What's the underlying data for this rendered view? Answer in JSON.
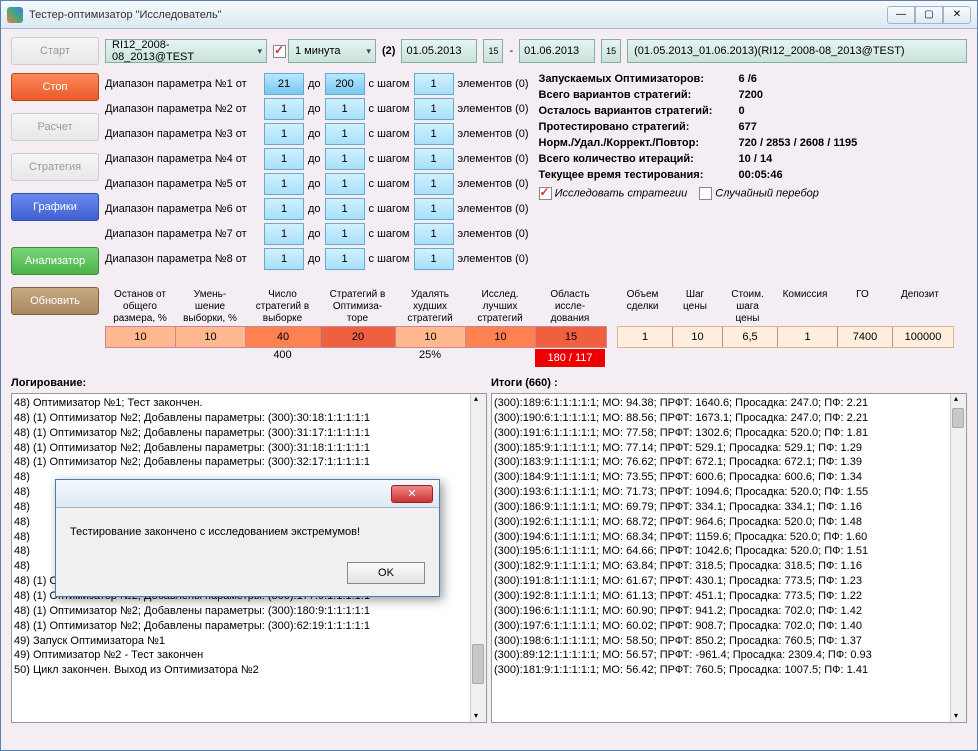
{
  "window": {
    "title": "Тестер-оптимизатор \"Исследователь\""
  },
  "top": {
    "strategy": "RI12_2008-08_2013@TEST",
    "timeframe": "1 минута",
    "count": "(2)",
    "date_from": "01.05.2013",
    "date_to": "01.06.2013",
    "info": "(01.05.2013_01.06.2013)(RI12_2008-08_2013@TEST)"
  },
  "buttons": {
    "start": "Старт",
    "stop": "Стоп",
    "calc": "Расчет",
    "strategy": "Стратегия",
    "charts": "Графики",
    "analyzer": "Анализатор",
    "refresh": "Обновить"
  },
  "params": [
    {
      "label": "Диапазон параметра №1 от",
      "from": "21",
      "to": "200",
      "step": "1",
      "elem": "элементов (0)"
    },
    {
      "label": "Диапазон параметра №2 от",
      "from": "1",
      "to": "1",
      "step": "1",
      "elem": "элементов (0)"
    },
    {
      "label": "Диапазон параметра №3 от",
      "from": "1",
      "to": "1",
      "step": "1",
      "elem": "элементов (0)"
    },
    {
      "label": "Диапазон параметра №4 от",
      "from": "1",
      "to": "1",
      "step": "1",
      "elem": "элементов (0)"
    },
    {
      "label": "Диапазон параметра №5 от",
      "from": "1",
      "to": "1",
      "step": "1",
      "elem": "элементов (0)"
    },
    {
      "label": "Диапазон параметра №6 от",
      "from": "1",
      "to": "1",
      "step": "1",
      "elem": "элементов (0)"
    },
    {
      "label": "Диапазон параметра №7 от",
      "from": "1",
      "to": "1",
      "step": "1",
      "elem": "элементов (0)"
    },
    {
      "label": "Диапазон параметра №8 от",
      "from": "1",
      "to": "1",
      "step": "1",
      "elem": "элементов (0)"
    }
  ],
  "words": {
    "to": "до",
    "step": "с шагом"
  },
  "stats": {
    "s1_label": "Запускаемых Оптимизаторов:",
    "s1_val": "6 /6",
    "s2_label": "Всего вариантов стратегий:",
    "s2_val": "7200",
    "s3_label": "Осталось вариантов стратегий:",
    "s3_val": "0",
    "s4_label": "Протестировано стратегий:",
    "s4_val": "677",
    "s5_label": "Норм./Удал./Коррект./Повтор:",
    "s5_val": "720 / 2853 / 2608 / 1195",
    "s6_label": "Всего количество итераций:",
    "s6_val": "10 / 14",
    "s7_label": "Текущее время тестирования:",
    "s7_val": "00:05:46"
  },
  "checks": {
    "research": "Исследовать стратегии",
    "random": "Случайный перебор"
  },
  "table": {
    "h1": "Останов от\nобщего\nразмера, %",
    "h2": "Умень-\nшение\nвыборки, %",
    "h3": "Число\nстратегий в\nвыборке",
    "h4": "Стратегий в\nОптимиза-\nторе",
    "h5": "Удалять\nхудших\nстратегий",
    "h6": "Исслед.\nлучших\nстратегий",
    "h7": "Область\nиссле-\nдования",
    "h8": "Объем\nсделки",
    "h9": "Шаг\nцены",
    "h10": "Стоим.\nшага\nцены",
    "h11": "Комиссия",
    "h12": "ГО",
    "h13": "Депозит",
    "v1": "10",
    "v2": "10",
    "v3": "40",
    "v4": "20",
    "v5": "10",
    "v6": "10",
    "v7": "15",
    "v8": "1",
    "v9": "10",
    "v10": "6,5",
    "v11": "1",
    "v12": "7400",
    "v13": "100000",
    "below3": "400",
    "below5": "25%",
    "below7": "180 / 117"
  },
  "log_title": "Логирование:",
  "results_title": "Итоги (660) :",
  "log_lines": [
    "48) Оптимизатор №1; Тест закончен.",
    "48) (1) Оптимизатор №2; Добавлены параметры: (300):30:18:1:1:1:1:1",
    "48) (1) Оптимизатор №2; Добавлены параметры: (300):31:17:1:1:1:1:1",
    "48) (1) Оптимизатор №2; Добавлены параметры: (300):31:18:1:1:1:1:1",
    "48) (1) Оптимизатор №2; Добавлены параметры: (300):32:17:1:1:1:1:1",
    "48)",
    "48)",
    "48)",
    "48)",
    "48)",
    "48)",
    "48)",
    "48) (1) Оптимизатор №2; Добавлены параметры: (300):176:9:1:1:1:1:1",
    "48) (1) Оптимизатор №2; Добавлены параметры: (300):177:9:1:1:1:1:1",
    "48) (1) Оптимизатор №2; Добавлены параметры: (300):180:9:1:1:1:1:1",
    "48) (1) Оптимизатор №2; Добавлены параметры: (300):62:19:1:1:1:1:1",
    "49) Запуск Оптимизатора №1",
    "49) Оптимизатор №2 - Тест закончен",
    "50) Цикл закончен. Выход из Оптимизатора №2"
  ],
  "result_lines": [
    "(300):189:6:1:1:1:1:1; МО: 94.38; ПРФТ: 1640.6; Просадка: 247.0; ПФ: 2.21",
    "(300):190:6:1:1:1:1:1; МО: 88.56; ПРФТ: 1673.1; Просадка: 247.0; ПФ: 2.21",
    "(300):191:6:1:1:1:1:1; МО: 77.58; ПРФТ: 1302.6; Просадка: 520.0; ПФ: 1.81",
    "(300):185:9:1:1:1:1:1; МО: 77.14; ПРФТ: 529.1; Просадка: 529.1; ПФ: 1.29",
    "(300):183:9:1:1:1:1:1; МО: 76.62; ПРФТ: 672.1; Просадка: 672.1; ПФ: 1.39",
    "(300):184:9:1:1:1:1:1; МО: 73.55; ПРФТ: 600.6; Просадка: 600.6; ПФ: 1.34",
    "(300):193:6:1:1:1:1:1; МО: 71.73; ПРФТ: 1094.6; Просадка: 520.0; ПФ: 1.55",
    "(300):186:9:1:1:1:1:1; МО: 69.79; ПРФТ: 334.1; Просадка: 334.1; ПФ: 1.16",
    "(300):192:6:1:1:1:1:1; МО: 68.72; ПРФТ: 964.6; Просадка: 520.0; ПФ: 1.48",
    "(300):194:6:1:1:1:1:1; МО: 68.34; ПРФТ: 1159.6; Просадка: 520.0; ПФ: 1.60",
    "(300):195:6:1:1:1:1:1; МО: 64.66; ПРФТ: 1042.6; Просадка: 520.0; ПФ: 1.51",
    "(300):182:9:1:1:1:1:1; МО: 63.84; ПРФТ: 318.5; Просадка: 318.5; ПФ: 1.16",
    "(300):191:8:1:1:1:1:1; МО: 61.67; ПРФТ: 430.1; Просадка: 773.5; ПФ: 1.23",
    "(300):192:8:1:1:1:1:1; МО: 61.13; ПРФТ: 451.1; Просадка: 773.5; ПФ: 1.22",
    "(300):196:6:1:1:1:1:1; МО: 60.90; ПРФТ: 941.2; Просадка: 702.0; ПФ: 1.42",
    "(300):197:6:1:1:1:1:1; МО: 60.02; ПРФТ: 908.7; Просадка: 702.0; ПФ: 1.40",
    "(300):198:6:1:1:1:1:1; МО: 58.50; ПРФТ: 850.2; Просадка: 760.5; ПФ: 1.37",
    "(300):89:12:1:1:1:1:1; МО: 56.57; ПРФТ: -961.4; Просадка: 2309.4; ПФ: 0.93",
    "(300):181:9:1:1:1:1:1; МО: 56.42; ПРФТ: 760.5; Просадка: 1007.5; ПФ: 1.41"
  ],
  "modal": {
    "message": "Тестирование закончено с исследованием экстремумов!",
    "ok": "OK"
  }
}
